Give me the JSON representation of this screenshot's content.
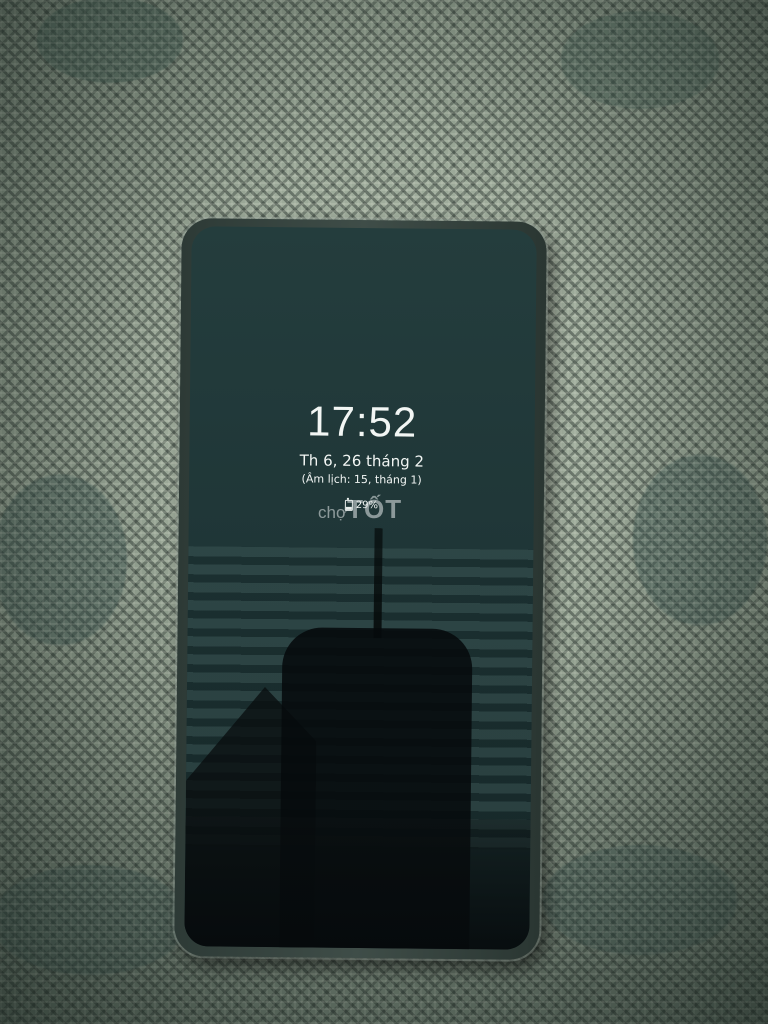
{
  "lockscreen": {
    "time": "17:52",
    "date": "Th 6, 26 tháng 2",
    "lunar_date": "(Âm lịch: 15, tháng 1)",
    "battery_text": "29%",
    "battery_level": 0.29,
    "battery_icon": "battery-icon"
  },
  "watermark": {
    "small": "chợ",
    "big": "TỐT"
  },
  "colors": {
    "screen": "#1f3637",
    "text": "#f2f6f4",
    "cloth": "#8d9a8c"
  }
}
